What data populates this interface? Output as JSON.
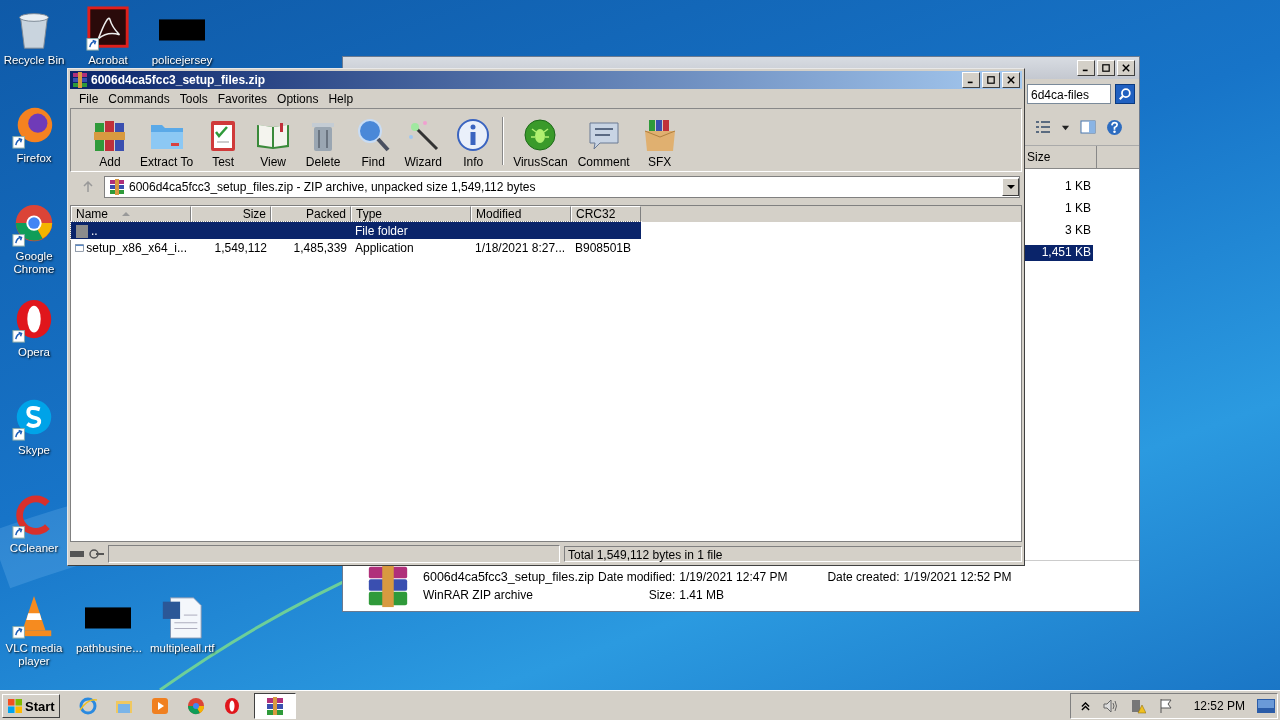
{
  "desktop_icons": [
    {
      "label": "Recycle Bin",
      "kind": "recycle",
      "shortcut": false
    },
    {
      "label": "Acrobat",
      "kind": "acrobat",
      "shortcut": true
    },
    {
      "label": "policejersey",
      "kind": "hidden",
      "shortcut": false
    },
    {
      "label": "Firefox",
      "kind": "firefox",
      "shortcut": true
    },
    {
      "label": "Google Chrome",
      "kind": "chrome",
      "shortcut": true
    },
    {
      "label": "Opera",
      "kind": "opera",
      "shortcut": true
    },
    {
      "label": "Skype",
      "kind": "skype",
      "shortcut": true
    },
    {
      "label": "CCleaner",
      "kind": "ccleaner",
      "shortcut": true
    },
    {
      "label": "VLC media player",
      "kind": "vlc",
      "shortcut": true
    },
    {
      "label": "pathbusine...",
      "kind": "hidden",
      "shortcut": false
    },
    {
      "label": "multipleall.rtf",
      "kind": "word",
      "shortcut": false
    }
  ],
  "explorer_window": {
    "search_value": "6d4ca-files",
    "column": "Size",
    "rows": [
      {
        "size": "1 KB",
        "selected": false
      },
      {
        "size": "1 KB",
        "selected": false
      },
      {
        "size": "3 KB",
        "selected": false
      },
      {
        "size": "1,451 KB",
        "selected": true
      }
    ],
    "details": {
      "name": "6006d4ca5fcc3_setup_files.zip",
      "type": "WinRAR ZIP archive",
      "modified_label": "Date modified:",
      "modified": "1/19/2021 12:47 PM",
      "created_label": "Date created:",
      "created": "1/19/2021 12:52 PM",
      "size_label": "Size:",
      "size": "1.41 MB"
    }
  },
  "winrar": {
    "title": "6006d4ca5fcc3_setup_files.zip",
    "menu": [
      "File",
      "Commands",
      "Tools",
      "Favorites",
      "Options",
      "Help"
    ],
    "toolbar": [
      {
        "label": "Add",
        "kind": "add"
      },
      {
        "label": "Extract To",
        "kind": "extract"
      },
      {
        "label": "Test",
        "kind": "test"
      },
      {
        "label": "View",
        "kind": "view"
      },
      {
        "label": "Delete",
        "kind": "delete"
      },
      {
        "label": "Find",
        "kind": "find"
      },
      {
        "label": "Wizard",
        "kind": "wizard"
      },
      {
        "label": "Info",
        "kind": "info"
      },
      {
        "label": "VirusScan",
        "kind": "virus",
        "group_start": true
      },
      {
        "label": "Comment",
        "kind": "comment"
      },
      {
        "label": "SFX",
        "kind": "sfx"
      }
    ],
    "path": "6006d4ca5fcc3_setup_files.zip - ZIP archive, unpacked size 1,549,112 bytes",
    "columns": [
      {
        "label": "Name",
        "sorted": true
      },
      {
        "label": "Size",
        "sorted": false
      },
      {
        "label": "Packed",
        "sorted": false
      },
      {
        "label": "Type",
        "sorted": false
      },
      {
        "label": "Modified",
        "sorted": false
      },
      {
        "label": "CRC32",
        "sorted": false
      }
    ],
    "rows": [
      {
        "kind": "folder",
        "name": "..",
        "type": "File folder",
        "selected": true
      },
      {
        "kind": "app",
        "name": "setup_x86_x64_i...",
        "size": "1,549,112",
        "packed": "1,485,339",
        "type": "Application",
        "modified": "1/18/2021 8:27...",
        "crc": "B908501B",
        "selected": false
      }
    ],
    "status": "Total 1,549,112 bytes in 1 file"
  },
  "taskbar": {
    "start": "Start",
    "apps": [
      {
        "kind": "ie",
        "selected": false
      },
      {
        "kind": "explorer",
        "selected": false
      },
      {
        "kind": "media",
        "selected": false
      },
      {
        "kind": "chrome",
        "selected": false
      },
      {
        "kind": "opera",
        "selected": false
      },
      {
        "kind": "winrar",
        "selected": true
      }
    ],
    "clock": "12:52 PM"
  }
}
